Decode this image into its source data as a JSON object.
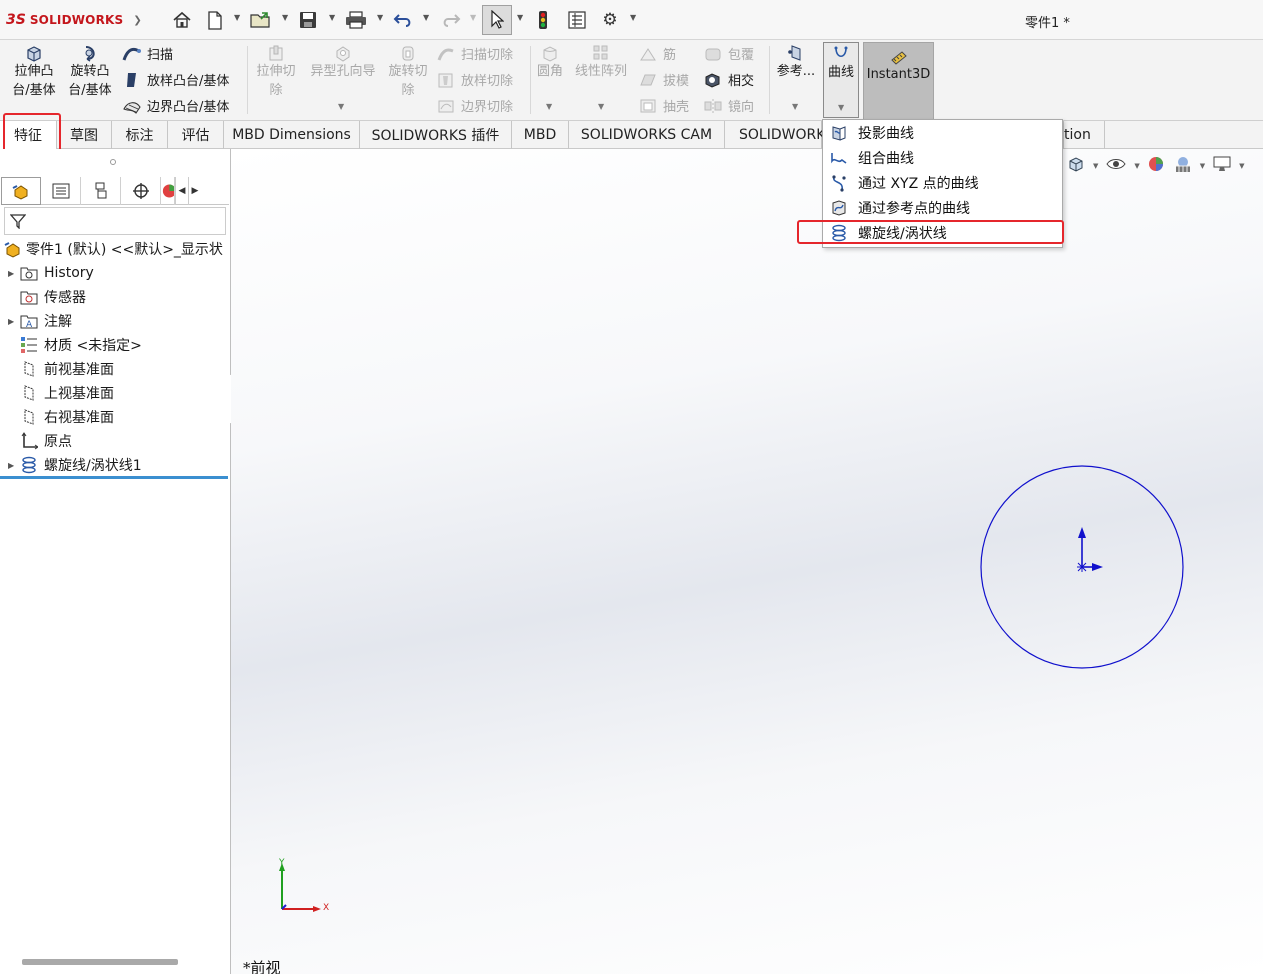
{
  "app": {
    "logo_mark": "3S",
    "logo_name": "SOLIDWORKS",
    "document_title": "零件1 *"
  },
  "quick_access": [
    {
      "name": "home-icon"
    },
    {
      "name": "new-document-icon"
    },
    {
      "name": "open-folder-icon"
    },
    {
      "name": "save-icon"
    },
    {
      "name": "print-icon"
    },
    {
      "name": "undo-icon"
    },
    {
      "name": "redo-icon"
    },
    {
      "name": "select-cursor-icon"
    },
    {
      "name": "rebuild-traffic-light-icon"
    },
    {
      "name": "file-properties-icon"
    },
    {
      "name": "options-gear-icon"
    }
  ],
  "ribbon": {
    "extrude_boss": "拉伸凸\n台/基体",
    "revolve_boss": "旋转凸\n台/基体",
    "sweep": "扫描",
    "loft_boss": "放样凸台/基体",
    "boundary_boss": "边界凸台/基体",
    "extrude_cut": "拉伸切\n除",
    "hole_wizard": "异型孔向导",
    "revolve_cut": "旋转切\n除",
    "swept_cut": "扫描切除",
    "lofted_cut": "放样切除",
    "boundary_cut": "边界切除",
    "fillet": "圆角",
    "linear_pattern": "线性阵列",
    "rib": "筋",
    "draft": "拔模",
    "shell": "抽壳",
    "wrap": "包覆",
    "intersect": "相交",
    "mirror": "镜向",
    "reference": "参考...",
    "curves": "曲线",
    "instant3d": "Instant3D"
  },
  "tabs": [
    {
      "label": "特征",
      "active": true
    },
    {
      "label": "草图"
    },
    {
      "label": "标注"
    },
    {
      "label": "评估"
    },
    {
      "label": "MBD Dimensions"
    },
    {
      "label": "SOLIDWORKS 插件"
    },
    {
      "label": "MBD"
    },
    {
      "label": "SOLIDWORKS CAM"
    },
    {
      "label": "SOLIDWORK"
    },
    {
      "label": "tion"
    }
  ],
  "curve_menu": {
    "items": [
      {
        "label": "投影曲线"
      },
      {
        "label": "组合曲线"
      },
      {
        "label": "通过 XYZ 点的曲线"
      },
      {
        "label": "通过参考点的曲线"
      },
      {
        "label": "螺旋线/涡状线"
      }
    ]
  },
  "tree": {
    "root": "零件1 (默认) <<默认>_显示状",
    "items": [
      {
        "label": "History",
        "expandable": true
      },
      {
        "label": "传感器"
      },
      {
        "label": "注解",
        "expandable": true
      },
      {
        "label": "材质 <未指定>"
      },
      {
        "label": "前视基准面"
      },
      {
        "label": "上视基准面"
      },
      {
        "label": "右视基准面"
      },
      {
        "label": "原点"
      },
      {
        "label": "螺旋线/涡状线1",
        "expandable": true
      }
    ]
  },
  "viewport": {
    "view_label": "*前视",
    "triad_x": "X",
    "triad_y": "Y"
  },
  "colors": {
    "accent_red": "#e5262c",
    "sketch_blue": "#1010cc",
    "rollback_blue": "#3b8fd0",
    "brand_red": "#c4161c"
  }
}
